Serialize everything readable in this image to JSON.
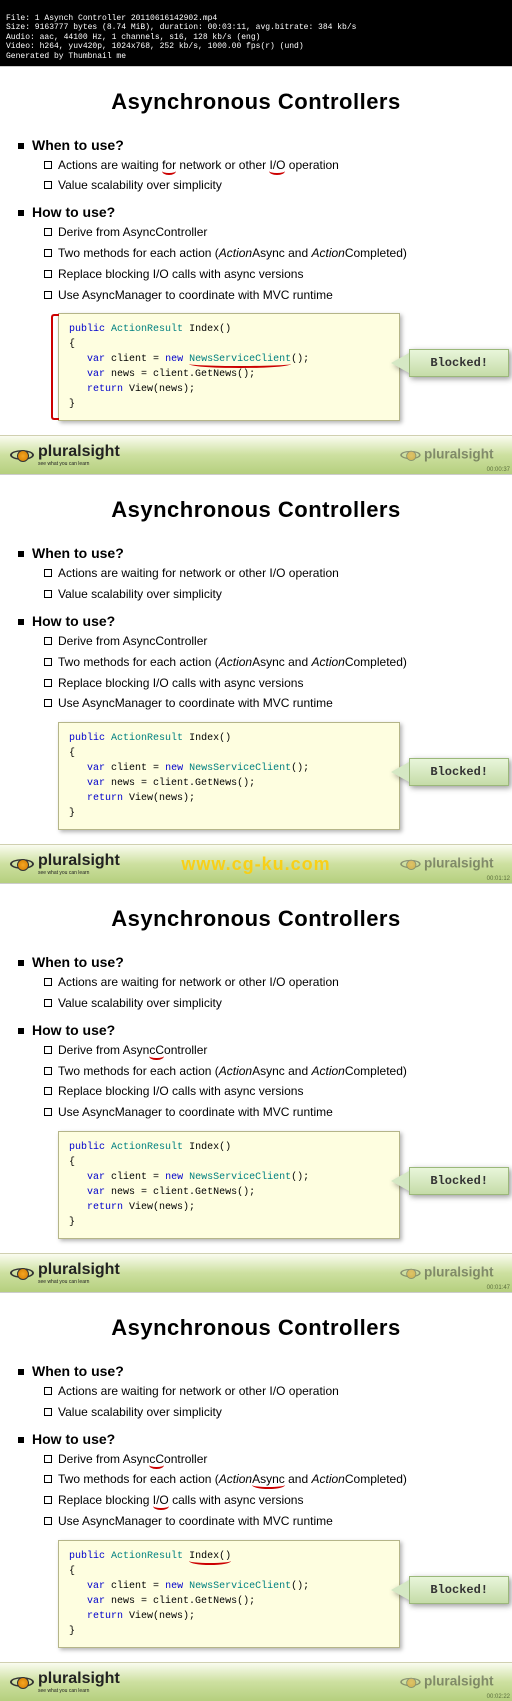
{
  "meta": {
    "file": "File: 1 Asynch Controller 20110616142902.mp4",
    "size": "Size: 9163777 bytes (8.74 MiB), duration: 00:03:11, avg.bitrate: 384 kb/s",
    "audio": "Audio: aac, 44100 Hz, 1 channels, s16, 128 kb/s (eng)",
    "video": "Video: h264, yuv420p, 1024x768, 252 kb/s, 1000.00 fps(r) (und)",
    "gen": "Generated by Thumbnail me"
  },
  "slide": {
    "title": "Asynchronous Controllers",
    "when_h": "When to use?",
    "when": [
      "Actions are waiting for network or other I/O operation",
      "Value scalability over simplicity"
    ],
    "how_h": "How to use?",
    "how": [
      "Derive from AsyncController",
      "Replace blocking I/O calls with async versions",
      "Use AsyncManager to coordinate with MVC runtime"
    ],
    "how_two_a": "Two methods for each action (",
    "how_two_b": "Async and ",
    "how_two_c": "Completed)",
    "action_word": "Action",
    "code": {
      "l1a": "public",
      "l1b": "ActionResult",
      "l1c": "Index()",
      "l2": "{",
      "l3a": "var",
      "l3b": "client =",
      "l3c": "new",
      "l3d": "NewsServiceClient",
      "l3e": "();",
      "l4a": "var",
      "l4b": "news = client.GetNews();",
      "l5a": "return",
      "l5b": "View(news);",
      "l6": "}"
    },
    "callout": "Blocked!"
  },
  "footer": {
    "brand": "pluralsight",
    "tag": "see what you can learn"
  },
  "timestamps": [
    "00:00:37",
    "00:01:12",
    "00:01:47",
    "00:02:22"
  ],
  "watermark": "www.cg-ku.com"
}
